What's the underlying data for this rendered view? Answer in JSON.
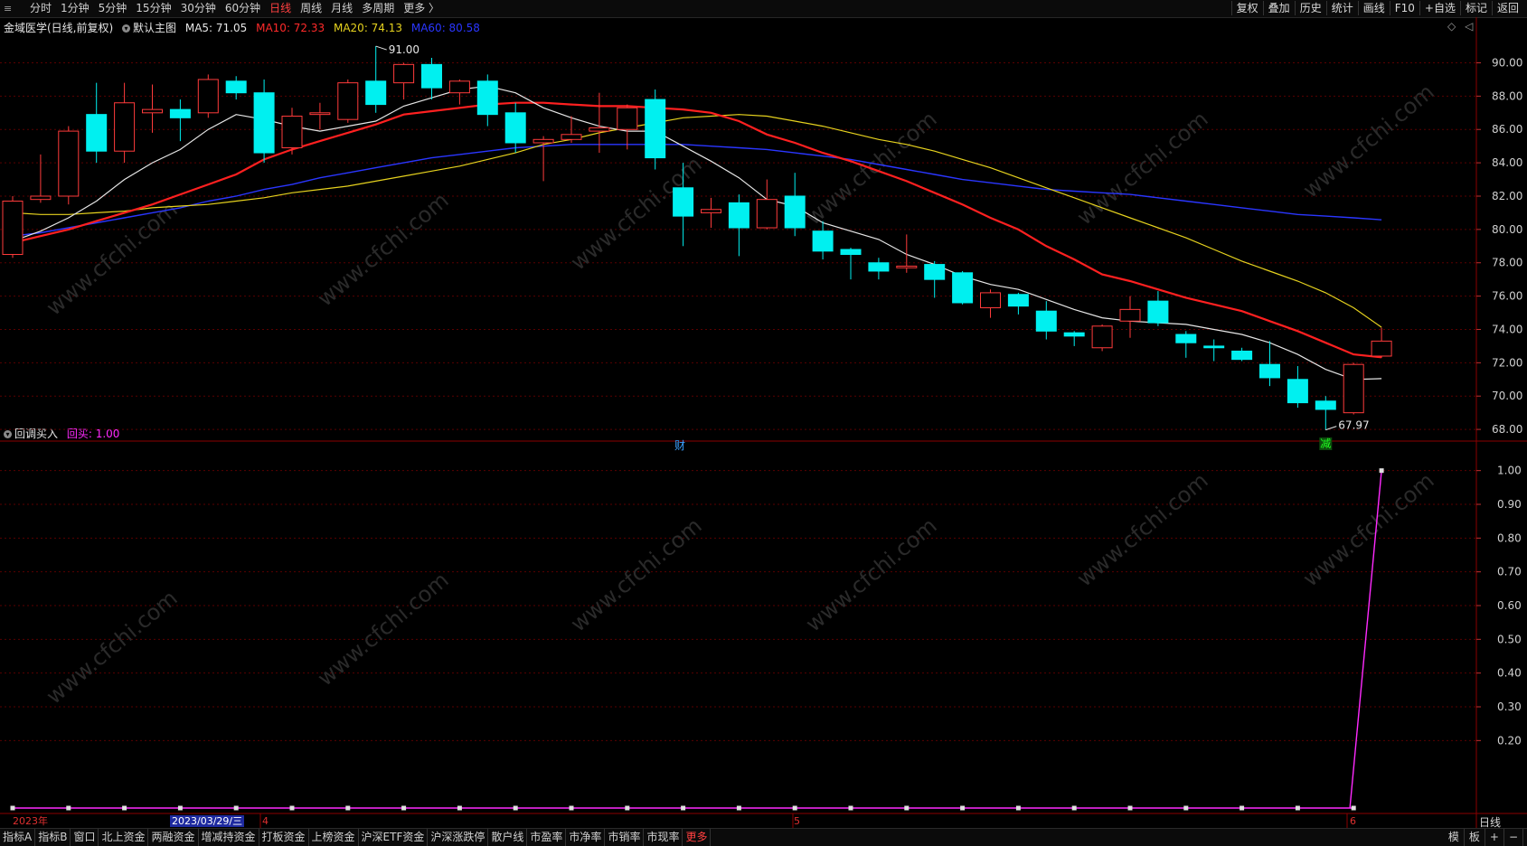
{
  "topbar": {
    "timeframes": [
      "分时",
      "1分钟",
      "5分钟",
      "15分钟",
      "30分钟",
      "60分钟",
      "日线",
      "周线",
      "月线",
      "多周期",
      "更多 〉"
    ],
    "active_timeframe": "日线",
    "right_buttons": [
      "复权",
      "叠加",
      "历史",
      "统计",
      "画线",
      "F10",
      "+自选",
      "标记",
      "返回"
    ]
  },
  "main_chart": {
    "stock_title": "金域医学(日线,前复权)",
    "template": "默认主图",
    "ma": [
      {
        "label": "MA5: 71.05",
        "color": "#e6e6e6"
      },
      {
        "label": "MA10: 72.33",
        "color": "#ff2a2a"
      },
      {
        "label": "MA20: 74.13",
        "color": "#e6d21e"
      },
      {
        "label": "MA60: 80.58",
        "color": "#2a36ff"
      }
    ],
    "y_ticks": [
      "90.00",
      "88.00",
      "86.00",
      "84.00",
      "82.00",
      "80.00",
      "78.00",
      "76.00",
      "74.00",
      "72.00",
      "70.00",
      "68.00"
    ],
    "high_label": "91.00",
    "low_label": "67.97",
    "marker_cai": "财",
    "marker_jian": "减"
  },
  "sub_chart": {
    "title": "回调买入",
    "value_label": "回买: 1.00",
    "y_ticks": [
      "1.00",
      "0.90",
      "0.80",
      "0.70",
      "0.60",
      "0.50",
      "0.40",
      "0.30",
      "0.20"
    ],
    "line_color": "#ff2aff"
  },
  "date_axis": {
    "labels": [
      "2023年",
      "2023/03/29/三",
      "4",
      "5",
      "6"
    ],
    "period_label": "日线"
  },
  "bottombar": {
    "tabs": [
      "指标A",
      "指标B",
      "窗口",
      "北上资金",
      "两融资金",
      "增减持资金",
      "打板资金",
      "上榜资金",
      "沪深ETF资金",
      "沪深涨跌停",
      "散户线",
      "市盈率",
      "市净率",
      "市销率",
      "市现率",
      "更多"
    ],
    "right": [
      "模",
      "板",
      "+",
      "−"
    ]
  },
  "colors": {
    "up": "#ff3b3b",
    "down": "#00f0f0",
    "grid": "#5a0000",
    "axis": "#8b0000"
  },
  "chart_data": {
    "type": "candlestick",
    "title": "金域医学(日线,前复权)",
    "ylim": [
      67,
      91.5
    ],
    "candles": [
      {
        "o": 78.5,
        "c": 81.7,
        "h": 82.0,
        "l": 78.3
      },
      {
        "o": 81.8,
        "c": 82.0,
        "h": 84.5,
        "l": 81.6
      },
      {
        "o": 82.0,
        "c": 85.9,
        "h": 86.2,
        "l": 81.5
      },
      {
        "o": 86.9,
        "c": 84.7,
        "h": 88.8,
        "l": 84.0
      },
      {
        "o": 84.7,
        "c": 87.6,
        "h": 88.8,
        "l": 84.0
      },
      {
        "o": 87.0,
        "c": 87.2,
        "h": 88.7,
        "l": 85.8
      },
      {
        "o": 87.2,
        "c": 86.7,
        "h": 87.8,
        "l": 85.3
      },
      {
        "o": 87.0,
        "c": 89.0,
        "h": 89.3,
        "l": 86.7
      },
      {
        "o": 88.9,
        "c": 88.2,
        "h": 89.2,
        "l": 87.8
      },
      {
        "o": 88.2,
        "c": 84.6,
        "h": 89.0,
        "l": 84.0
      },
      {
        "o": 84.9,
        "c": 86.8,
        "h": 87.3,
        "l": 84.5
      },
      {
        "o": 86.9,
        "c": 87.0,
        "h": 87.6,
        "l": 86.0
      },
      {
        "o": 86.6,
        "c": 88.8,
        "h": 89.0,
        "l": 86.4
      },
      {
        "o": 88.9,
        "c": 87.5,
        "h": 91.0,
        "l": 87.0
      },
      {
        "o": 88.8,
        "c": 89.9,
        "h": 90.0,
        "l": 87.8
      },
      {
        "o": 89.9,
        "c": 88.5,
        "h": 90.3,
        "l": 87.8
      },
      {
        "o": 88.2,
        "c": 88.9,
        "h": 89.0,
        "l": 87.5
      },
      {
        "o": 88.9,
        "c": 86.9,
        "h": 89.3,
        "l": 86.2
      },
      {
        "o": 87.0,
        "c": 85.2,
        "h": 87.6,
        "l": 84.6
      },
      {
        "o": 85.2,
        "c": 85.4,
        "h": 85.6,
        "l": 82.9
      },
      {
        "o": 85.4,
        "c": 85.7,
        "h": 86.8,
        "l": 85.2
      },
      {
        "o": 85.9,
        "c": 86.1,
        "h": 88.2,
        "l": 84.6
      },
      {
        "o": 86.0,
        "c": 87.3,
        "h": 87.5,
        "l": 84.8
      },
      {
        "o": 87.8,
        "c": 84.3,
        "h": 88.4,
        "l": 83.6
      },
      {
        "o": 82.5,
        "c": 80.8,
        "h": 84.0,
        "l": 79.0
      },
      {
        "o": 81.0,
        "c": 81.2,
        "h": 81.9,
        "l": 80.1
      },
      {
        "o": 81.6,
        "c": 80.1,
        "h": 82.1,
        "l": 78.4
      },
      {
        "o": 80.1,
        "c": 81.8,
        "h": 83.0,
        "l": 80.0
      },
      {
        "o": 82.0,
        "c": 80.1,
        "h": 83.4,
        "l": 79.6
      },
      {
        "o": 79.9,
        "c": 78.7,
        "h": 80.5,
        "l": 78.2
      },
      {
        "o": 78.8,
        "c": 78.5,
        "h": 78.9,
        "l": 77.0
      },
      {
        "o": 78.0,
        "c": 77.5,
        "h": 78.3,
        "l": 77.0
      },
      {
        "o": 77.7,
        "c": 77.8,
        "h": 79.7,
        "l": 77.4
      },
      {
        "o": 77.9,
        "c": 77.0,
        "h": 78.1,
        "l": 75.9
      },
      {
        "o": 77.4,
        "c": 75.6,
        "h": 77.5,
        "l": 75.5
      },
      {
        "o": 75.3,
        "c": 76.2,
        "h": 76.4,
        "l": 74.7
      },
      {
        "o": 76.1,
        "c": 75.4,
        "h": 76.2,
        "l": 74.9
      },
      {
        "o": 75.1,
        "c": 73.9,
        "h": 75.7,
        "l": 73.4
      },
      {
        "o": 73.8,
        "c": 73.6,
        "h": 73.9,
        "l": 73.0
      },
      {
        "o": 72.9,
        "c": 74.2,
        "h": 74.3,
        "l": 72.7
      },
      {
        "o": 74.5,
        "c": 75.2,
        "h": 76.0,
        "l": 73.5
      },
      {
        "o": 75.7,
        "c": 74.4,
        "h": 76.3,
        "l": 74.2
      },
      {
        "o": 73.7,
        "c": 73.2,
        "h": 73.9,
        "l": 72.3
      },
      {
        "o": 73.0,
        "c": 72.9,
        "h": 73.4,
        "l": 72.1
      },
      {
        "o": 72.7,
        "c": 72.2,
        "h": 72.9,
        "l": 72.1
      },
      {
        "o": 71.9,
        "c": 71.1,
        "h": 73.3,
        "l": 70.6
      },
      {
        "o": 71.0,
        "c": 69.6,
        "h": 71.8,
        "l": 69.3
      },
      {
        "o": 69.7,
        "c": 69.2,
        "h": 70.0,
        "l": 67.97
      },
      {
        "o": 69.0,
        "c": 71.9,
        "h": 72.0,
        "l": 68.9
      },
      {
        "o": 72.4,
        "c": 73.3,
        "h": 74.1,
        "l": 72.3
      }
    ],
    "ma5": [
      79.3,
      79.9,
      80.7,
      81.7,
      83.0,
      84.0,
      84.8,
      86.0,
      86.9,
      86.6,
      86.2,
      85.9,
      86.2,
      86.5,
      87.4,
      87.9,
      88.4,
      88.6,
      88.2,
      87.3,
      86.7,
      86.2,
      85.9,
      85.9,
      85.0,
      84.1,
      83.1,
      81.8,
      81.4,
      80.4,
      79.9,
      79.4,
      78.5,
      77.9,
      77.2,
      76.7,
      76.4,
      75.8,
      75.2,
      74.7,
      74.5,
      74.4,
      74.3,
      74.0,
      73.7,
      73.2,
      72.5,
      71.6,
      71.0,
      71.05
    ],
    "ma10": [
      79.2,
      79.6,
      80.0,
      80.5,
      81.0,
      81.5,
      82.1,
      82.7,
      83.3,
      84.2,
      84.8,
      85.3,
      85.8,
      86.3,
      86.9,
      87.1,
      87.3,
      87.5,
      87.6,
      87.6,
      87.5,
      87.4,
      87.4,
      87.3,
      87.2,
      87.0,
      86.5,
      85.7,
      85.2,
      84.6,
      84.1,
      83.5,
      82.9,
      82.2,
      81.5,
      80.7,
      80.0,
      79.0,
      78.2,
      77.3,
      76.9,
      76.4,
      75.9,
      75.5,
      75.1,
      74.5,
      73.9,
      73.2,
      72.5,
      72.33
    ],
    "ma20": [
      81.0,
      80.9,
      80.9,
      81.0,
      81.1,
      81.3,
      81.4,
      81.5,
      81.7,
      81.9,
      82.2,
      82.4,
      82.6,
      82.9,
      83.2,
      83.5,
      83.8,
      84.2,
      84.6,
      85.1,
      85.4,
      85.8,
      86.1,
      86.4,
      86.7,
      86.8,
      86.9,
      86.8,
      86.5,
      86.2,
      85.8,
      85.4,
      85.1,
      84.7,
      84.2,
      83.7,
      83.1,
      82.5,
      81.9,
      81.3,
      80.7,
      80.1,
      79.5,
      78.8,
      78.1,
      77.5,
      76.9,
      76.2,
      75.3,
      74.13
    ],
    "ma60": [
      79.6,
      79.8,
      80.1,
      80.4,
      80.7,
      81.0,
      81.3,
      81.7,
      82.0,
      82.4,
      82.7,
      83.1,
      83.4,
      83.7,
      84.0,
      84.3,
      84.5,
      84.7,
      84.9,
      85.0,
      85.1,
      85.1,
      85.1,
      85.1,
      85.1,
      85.0,
      84.9,
      84.8,
      84.6,
      84.4,
      84.2,
      83.9,
      83.6,
      83.3,
      83.0,
      82.8,
      82.6,
      82.4,
      82.3,
      82.2,
      82.1,
      81.9,
      81.7,
      81.5,
      81.3,
      81.1,
      80.9,
      80.8,
      80.7,
      80.58
    ],
    "signal": [
      0,
      0,
      0,
      0,
      0,
      0,
      0,
      0,
      0,
      0,
      0,
      0,
      0,
      0,
      0,
      0,
      0,
      0,
      0,
      0,
      0,
      0,
      0,
      0,
      0,
      0,
      0,
      0,
      0,
      0,
      0,
      0,
      0,
      0,
      0,
      0,
      0,
      0,
      0,
      0,
      0,
      0,
      0,
      0,
      0,
      0,
      0,
      0,
      0,
      1.0
    ],
    "sub_ylim": [
      0,
      1.05
    ]
  }
}
